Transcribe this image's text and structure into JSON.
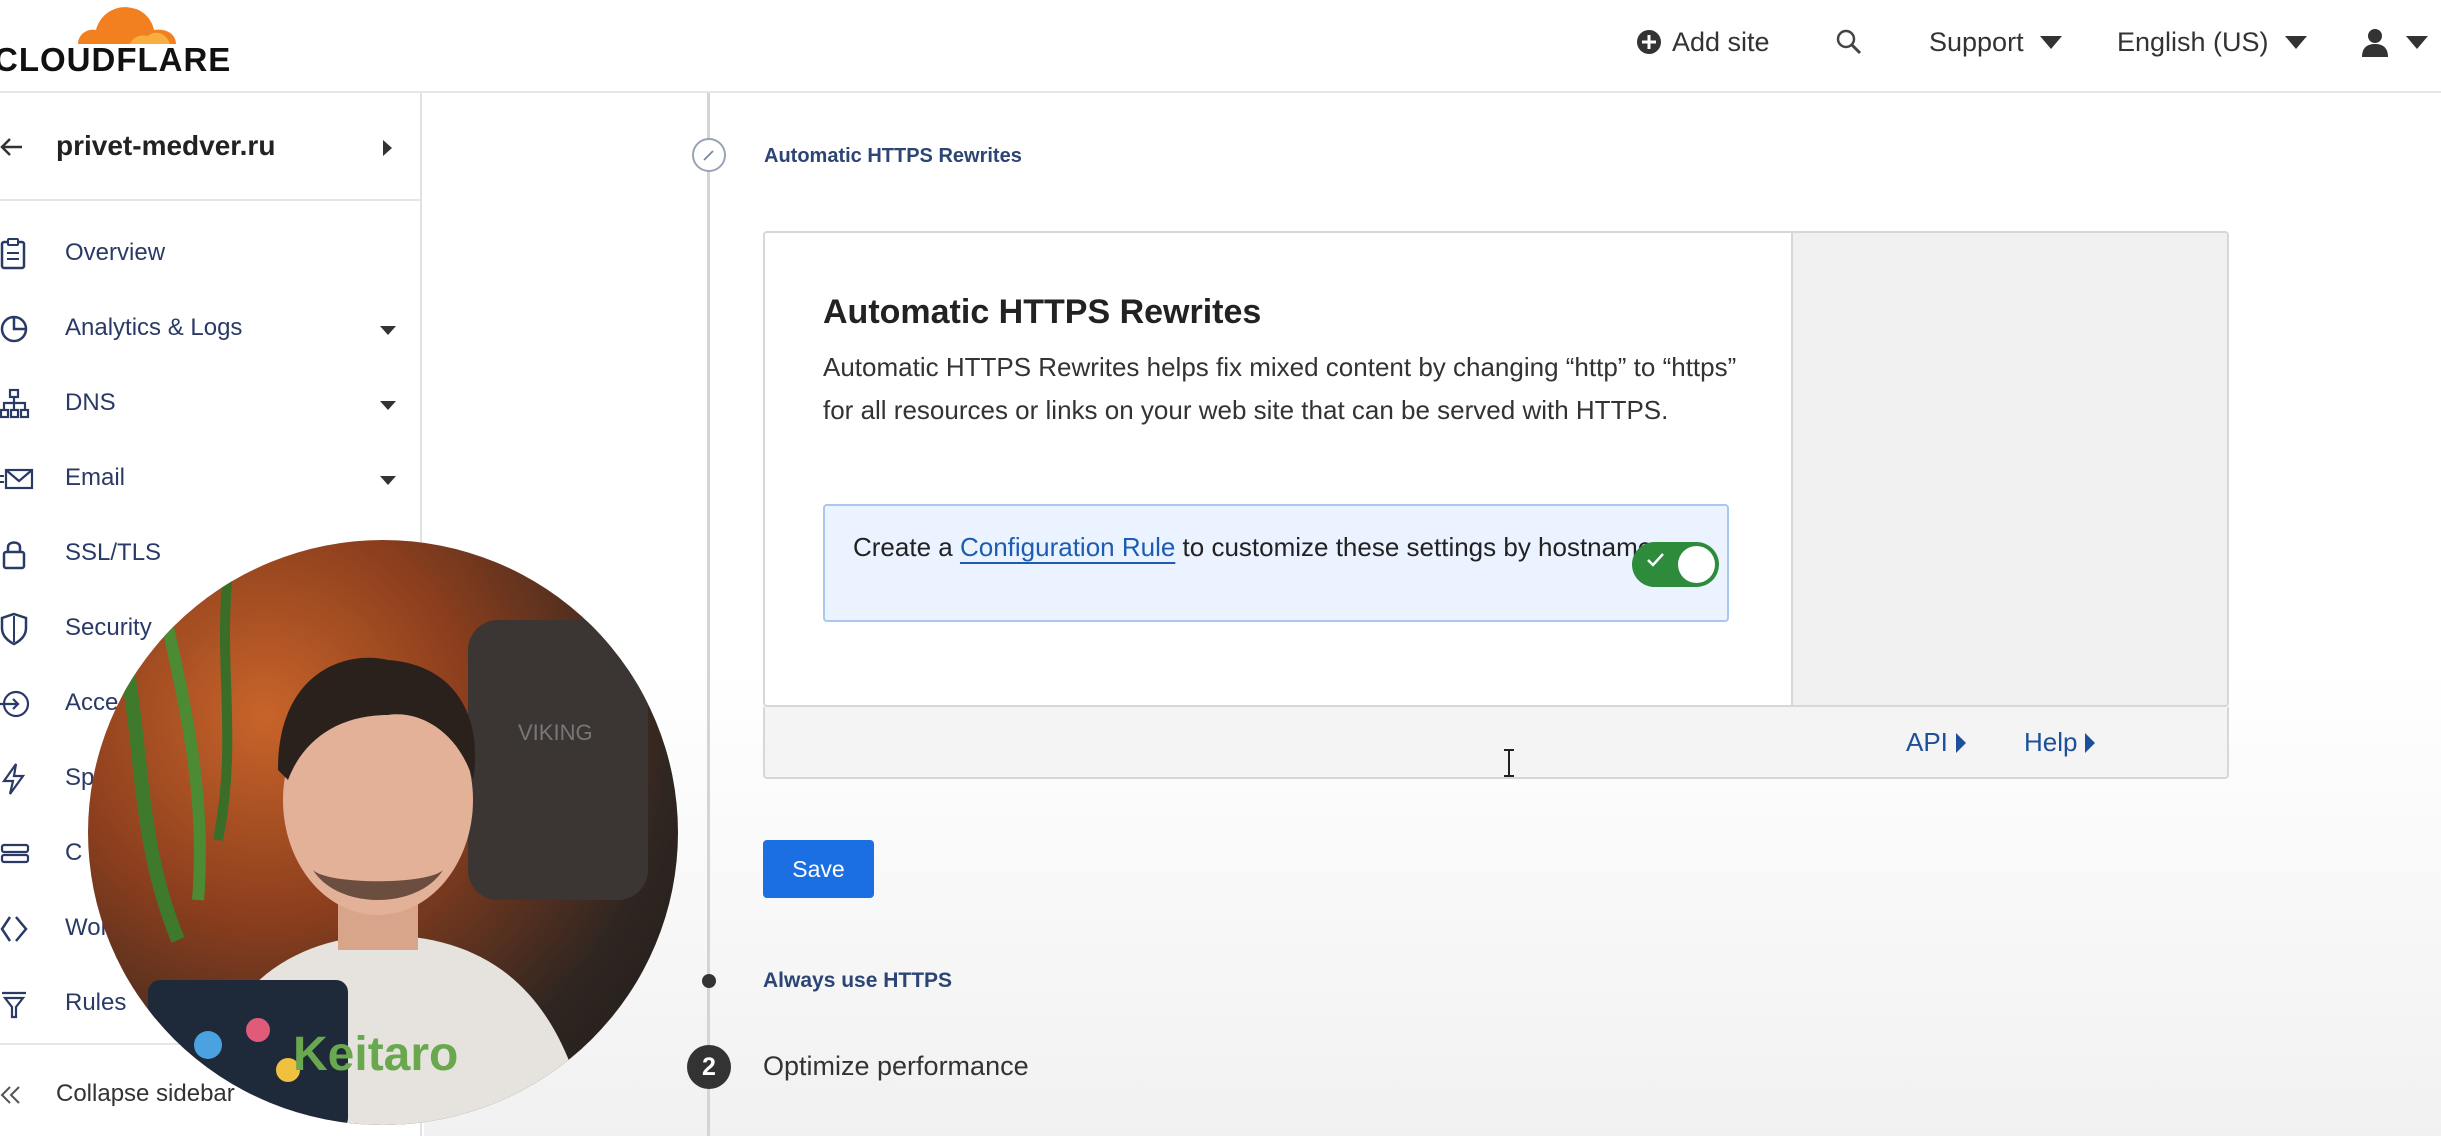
{
  "header": {
    "logo_text": "CLOUDFLARE",
    "add_site": "Add site",
    "support": "Support",
    "language": "English (US)"
  },
  "sidebar": {
    "site_name": "privet-medver.ru",
    "items": [
      {
        "label": "Overview",
        "icon": "clipboard-icon",
        "has_caret": false
      },
      {
        "label": "Analytics & Logs",
        "icon": "pie-chart-icon",
        "has_caret": true
      },
      {
        "label": "DNS",
        "icon": "network-icon",
        "has_caret": true
      },
      {
        "label": "Email",
        "icon": "envelope-icon",
        "has_caret": true
      },
      {
        "label": "SSL/TLS",
        "icon": "lock-icon",
        "has_caret": false
      },
      {
        "label": "Security",
        "icon": "shield-icon",
        "has_caret": false
      },
      {
        "label": "Acce",
        "icon": "access-icon",
        "has_caret": false
      },
      {
        "label": "Sp",
        "icon": "lightning-icon",
        "has_caret": false
      },
      {
        "label": "C",
        "icon": "stack-icon",
        "has_caret": false
      },
      {
        "label": "Wor",
        "icon": "workers-icon",
        "has_caret": false
      },
      {
        "label": "Rules",
        "icon": "funnel-icon",
        "has_caret": false
      }
    ],
    "collapse_label": "Collapse sidebar"
  },
  "main": {
    "step_title": "Automatic HTTPS Rewrites",
    "card": {
      "title": "Automatic HTTPS Rewrites",
      "description": "Automatic HTTPS Rewrites helps fix mixed content by changing “http” to “https” for all resources or links on your web site that can be served with HTTPS.",
      "callout_before": "Create a ",
      "callout_link": "Configuration Rule",
      "callout_after": " to customize these settings by hostname.",
      "toggle_on": true
    },
    "footer": {
      "api": "API",
      "help": "Help"
    },
    "save_label": "Save",
    "sub_step": "Always use HTTPS",
    "next_step_number": "2",
    "next_step_label": "Optimize performance"
  },
  "colors": {
    "accent": "#1b6fe3",
    "toggle_on": "#2e8b3c",
    "link": "#1d4f9c",
    "callout_bg": "#eaf3ff",
    "logo_orange": "#f38020"
  }
}
